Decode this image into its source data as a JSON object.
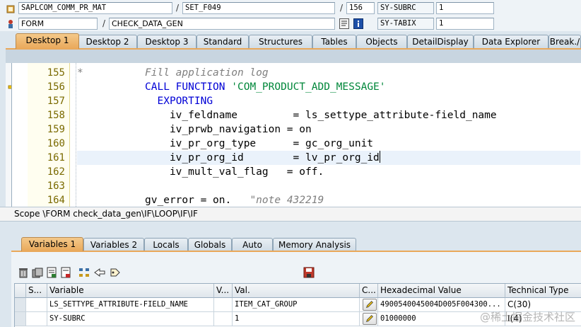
{
  "info": {
    "row1": {
      "program": "SAPLCOM_COMM_PR_MAT",
      "include": "SET_F049",
      "line": "156",
      "sysvar_name": "SY-SUBRC",
      "sysvar_value": "1"
    },
    "row2": {
      "event_type": "FORM",
      "event_name": "CHECK_DATA_GEN",
      "sysvar_name": "SY-TABIX",
      "sysvar_value": "1"
    }
  },
  "desktop_tabs": [
    "Desktop 1",
    "Desktop 2",
    "Desktop 3",
    "Standard",
    "Structures",
    "Tables",
    "Objects",
    "DetailDisplay",
    "Data Explorer",
    "Break./"
  ],
  "active_desktop_tab": "Desktop 1",
  "code": {
    "lines": [
      {
        "no": "155",
        "parts": [
          {
            "t": "*          Fill application log",
            "c": "cmt"
          }
        ]
      },
      {
        "no": "156",
        "parts": [
          {
            "t": "           ",
            "c": ""
          },
          {
            "t": "CALL FUNCTION",
            "c": "kw"
          },
          {
            "t": " ",
            "c": ""
          },
          {
            "t": "'COM_PRODUCT_ADD_MESSAGE'",
            "c": "str"
          }
        ]
      },
      {
        "no": "157",
        "parts": [
          {
            "t": "             ",
            "c": ""
          },
          {
            "t": "EXPORTING",
            "c": "kw"
          }
        ]
      },
      {
        "no": "158",
        "parts": [
          {
            "t": "               iv_feldname         = ls_settype_attribute-field_name",
            "c": ""
          }
        ]
      },
      {
        "no": "159",
        "parts": [
          {
            "t": "               iv_prwb_navigation = on",
            "c": ""
          }
        ]
      },
      {
        "no": "160",
        "parts": [
          {
            "t": "               iv_pr_org_type      = gc_org_unit",
            "c": ""
          }
        ]
      },
      {
        "no": "161",
        "parts": [
          {
            "t": "               iv_pr_org_id        = lv_pr_org_id",
            "c": ""
          }
        ]
      },
      {
        "no": "162",
        "parts": [
          {
            "t": "               iv_mult_val_flag   = off.",
            "c": ""
          }
        ]
      },
      {
        "no": "163",
        "parts": [
          {
            "t": "",
            "c": ""
          }
        ]
      },
      {
        "no": "164",
        "parts": [
          {
            "t": "           gv_error = on.   ",
            "c": ""
          },
          {
            "t": "\"note 432219",
            "c": "cmt"
          }
        ]
      }
    ],
    "current_line": "156",
    "highlight_line": "161"
  },
  "scope": "Scope \\FORM check_data_gen\\IF\\LOOP\\IF\\IF",
  "var_tabs": [
    "Variables 1",
    "Variables 2",
    "Locals",
    "Globals",
    "Auto",
    "Memory Analysis"
  ],
  "active_var_tab": "Variables 1",
  "grid": {
    "headers": [
      "S...",
      "Variable",
      "V...",
      "Val.",
      "C...",
      "Hexadecimal Value",
      "Technical Type"
    ],
    "rows": [
      {
        "variable": "LS_SETTYPE_ATTRIBUTE-FIELD_NAME",
        "value": "ITEM_CAT_GROUP",
        "hex": "4900540045004D005F004300...",
        "type": "C(30)"
      },
      {
        "variable": "SY-SUBRC",
        "value": "1",
        "hex": "01000000",
        "type": "I(4)"
      }
    ]
  },
  "watermark": "@稀土掘金技术社区",
  "colors": {
    "active_tab": "#e9a85a",
    "keyword": "#0000d6",
    "string": "#00873a",
    "comment": "#7f7f7f"
  }
}
